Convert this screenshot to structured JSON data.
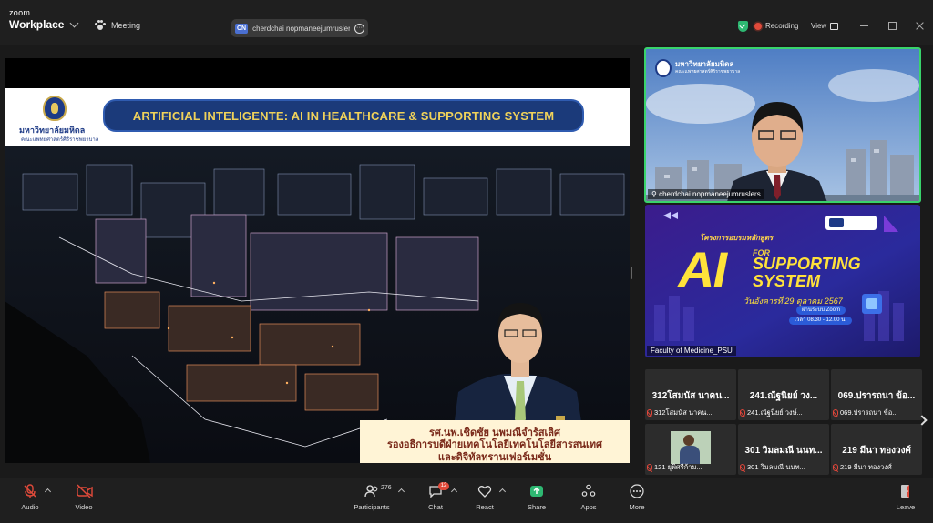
{
  "app": {
    "brand_small": "zoom",
    "brand_main": "Workplace"
  },
  "header": {
    "meeting_label": "Meeting",
    "speaker_badge": "CN",
    "speaker_name": "cherdchai nopmaneejumruslers'",
    "recording_label": "Recording",
    "view_label": "View"
  },
  "share": {
    "university": "มหาวิทยาลัยมหิดล",
    "faculty": "คณะแพทยศาสตร์ศิริราชพยาบาล",
    "title": "ARTIFICIAL INTELIGENTE: AI IN HEALTHCARE & SUPPORTING SYSTEM",
    "caption_line1": "รศ.นพ.เชิดชัย  นพมณีจำรัสเลิศ",
    "caption_line2": "รองอธิการบดีฝ่ายเทคโนโลยีเทคโนโลยีสารสนเทศ",
    "caption_line3": "และดิจิทัลทรานเฟอร์เมชั่น"
  },
  "speaker_tile": {
    "logo_title": "มหาวิทยาลัยมหิดล",
    "logo_sub": "คณะแพทยศาสตร์ศิริราชพยาบาล",
    "name": "cherdchai nopmaneejumruslers"
  },
  "promo_tile": {
    "subtitle": "โครงการอบรมหลักสูตร",
    "ai_text": "AI",
    "for_text": "FOR",
    "line1": "SUPPORTING",
    "line2": "SYSTEM",
    "date": "วันอังคารที่ 29 ตุลาคม 2567",
    "pill1": "ผ่านระบบ Zoom",
    "pill2": "เวลา 08.30 - 12.00 น.",
    "name": "Faculty of Medicine_PSU"
  },
  "gallery": [
    {
      "big": "312โสมนัส นาคน...",
      "small": "312โสมนัส นาคน..."
    },
    {
      "big": "241.ณัฐนิยย์  วง...",
      "small": "241.ณัฐนิยย์  วงษ์..."
    },
    {
      "big": "069.ปรารถนา ข้อ...",
      "small": "069.ปรารถนา ข้อ..."
    },
    {
      "big": "",
      "small": "121 ยุพิศรีก้าม..."
    },
    {
      "big": "301 วิมลมณี นนท...",
      "small": "301 วิมลมณี นนท..."
    },
    {
      "big": "219 มีนา ทองวงศ์",
      "small": "219 มีนา ทองวงศ์"
    }
  ],
  "toolbar": {
    "audio": "Audio",
    "video": "Video",
    "participants": "Participants",
    "participants_count": "276",
    "chat": "Chat",
    "chat_badge": "12",
    "react": "React",
    "share": "Share",
    "apps": "Apps",
    "more": "More",
    "leave": "Leave"
  },
  "colors": {
    "accent_green": "#39d36b",
    "share_green": "#2eb872",
    "danger_red": "#e04a3a",
    "slide_title_bg": "#1b3a7a",
    "slide_title_text": "#f0d25a"
  }
}
